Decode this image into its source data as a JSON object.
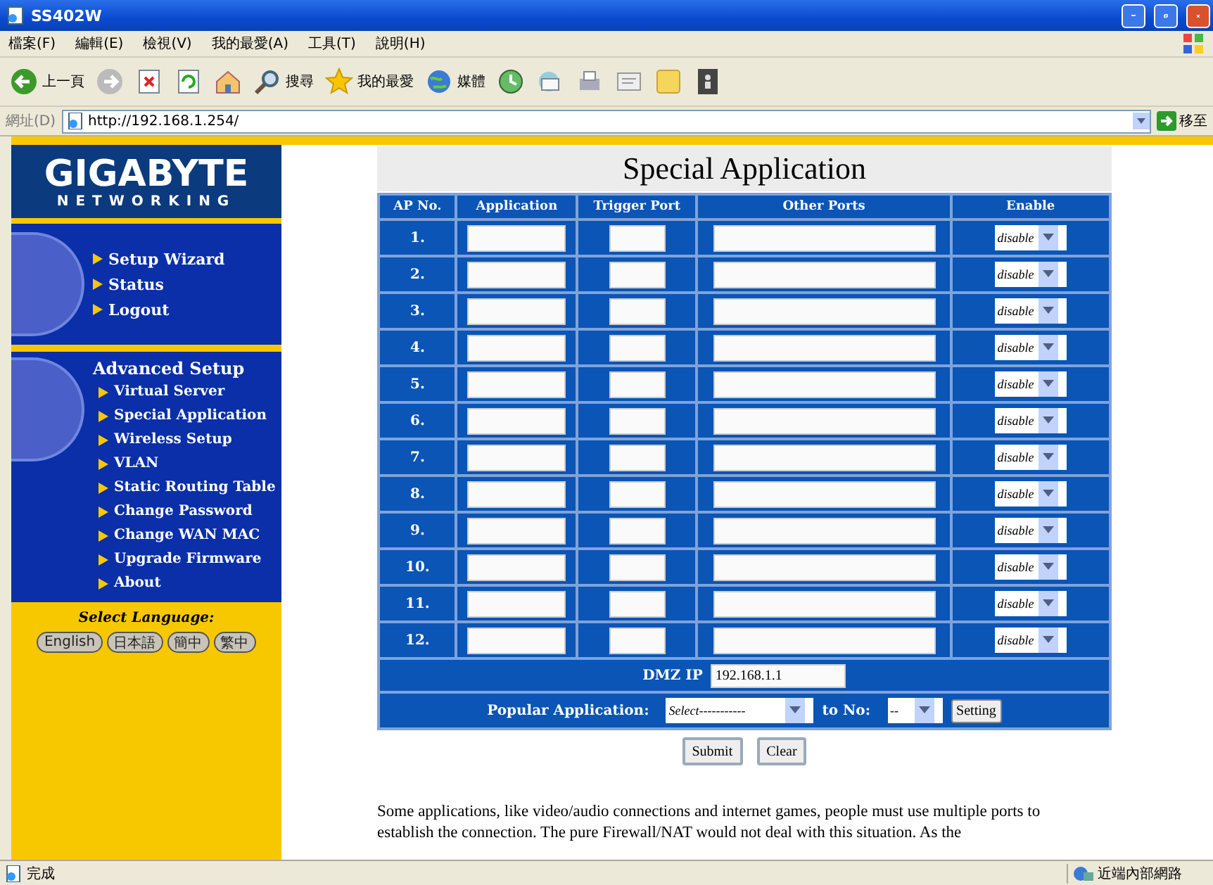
{
  "window": {
    "title": "SS402W"
  },
  "menu": [
    "檔案(F)",
    "編輯(E)",
    "檢視(V)",
    "我的最愛(A)",
    "工具(T)",
    "說明(H)"
  ],
  "toolbar": [
    {
      "kind": "back",
      "label": "上一頁"
    },
    {
      "kind": "forward"
    },
    {
      "kind": "stop"
    },
    {
      "kind": "refresh"
    },
    {
      "kind": "home"
    },
    {
      "kind": "search",
      "label": "搜尋"
    },
    {
      "kind": "favorites",
      "label": "我的最愛"
    },
    {
      "kind": "media",
      "label": "媒體"
    },
    {
      "kind": "history"
    },
    {
      "kind": "mail"
    },
    {
      "kind": "print"
    },
    {
      "kind": "edit"
    },
    {
      "kind": "note"
    },
    {
      "kind": "messenger"
    }
  ],
  "address_bar": {
    "label": "網址(D)",
    "url": "http://192.168.1.254/",
    "go_label": "移至"
  },
  "sidebar": {
    "logo": "GIGABYTE",
    "logo_sub": "NETWORKING",
    "main_links": [
      "Setup Wizard",
      "Status",
      "Logout"
    ],
    "advanced_title": "Advanced Setup",
    "advanced_links": [
      "Virtual Server",
      "Special Application",
      "Wireless Setup",
      "VLAN",
      "Static Routing Table",
      "Change Password",
      "Change WAN MAC",
      "Upgrade Firmware",
      "About"
    ],
    "language_label": "Select Language:",
    "languages": [
      "English",
      "日本語",
      "簡中",
      "繁中"
    ]
  },
  "page": {
    "title": "Special Application",
    "columns": [
      "AP No.",
      "Application",
      "Trigger Port",
      "Other Ports",
      "Enable"
    ],
    "rows": [
      {
        "no": "1.",
        "enable": "disable"
      },
      {
        "no": "2.",
        "enable": "disable"
      },
      {
        "no": "3.",
        "enable": "disable"
      },
      {
        "no": "4.",
        "enable": "disable"
      },
      {
        "no": "5.",
        "enable": "disable"
      },
      {
        "no": "6.",
        "enable": "disable"
      },
      {
        "no": "7.",
        "enable": "disable"
      },
      {
        "no": "8.",
        "enable": "disable"
      },
      {
        "no": "9.",
        "enable": "disable"
      },
      {
        "no": "10.",
        "enable": "disable"
      },
      {
        "no": "11.",
        "enable": "disable"
      },
      {
        "no": "12.",
        "enable": "disable"
      }
    ],
    "dmz": {
      "label": "DMZ IP",
      "value": "192.168.1.1"
    },
    "popular": {
      "label": "Popular Application:",
      "select": "Select-----------",
      "to_label": "to No:",
      "to_value": "--",
      "setting": "Setting"
    },
    "buttons": [
      "Submit",
      "Clear"
    ],
    "description": "Some applications, like video/audio connections and internet games, people must use multiple ports to establish the connection. The pure Firewall/NAT would not deal with this situation. As the"
  },
  "status_bar": {
    "text": "完成",
    "zone": "近端內部網路"
  }
}
